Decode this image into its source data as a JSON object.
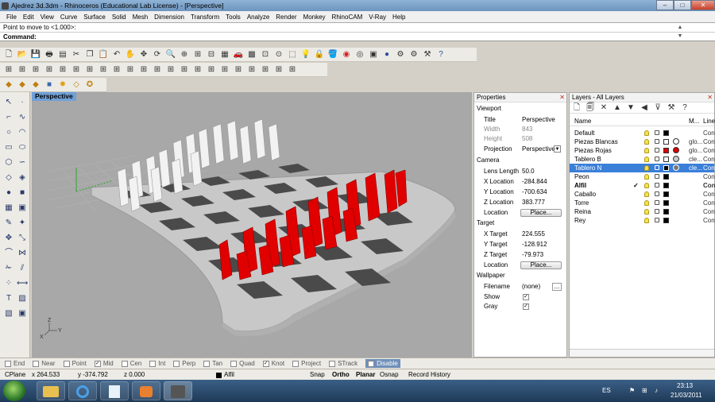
{
  "title": "Ajedrez 3d.3dm - Rhinoceros (Educational Lab License) - [Perspective]",
  "menu": [
    "File",
    "Edit",
    "View",
    "Curve",
    "Surface",
    "Solid",
    "Mesh",
    "Dimension",
    "Transform",
    "Tools",
    "Analyze",
    "Render",
    "Monkey",
    "RhinoCAM",
    "V-Ray",
    "Help"
  ],
  "command_history": "Point to move to <1.000>:",
  "command_prompt": "Command:",
  "viewport": {
    "label": "Perspective",
    "axis_y": "Y",
    "axis_z": "Z",
    "axis_x": "X"
  },
  "properties": {
    "header": "Properties",
    "viewport_section": "Viewport",
    "title_key": "Title",
    "title_val": "Perspective",
    "width_key": "Width",
    "width_val": "843",
    "height_key": "Height",
    "height_val": "508",
    "projection_key": "Projection",
    "projection_val": "Perspective",
    "camera_section": "Camera",
    "lens_key": "Lens Length",
    "lens_val": "50.0",
    "cx_key": "X Location",
    "cx_val": "-284.844",
    "cy_key": "Y Location",
    "cy_val": "-700.634",
    "cz_key": "Z Location",
    "cz_val": "383.777",
    "cloc_key": "Location",
    "place_btn": "Place...",
    "target_section": "Target",
    "tx_key": "X Target",
    "tx_val": "224.555",
    "ty_key": "Y Target",
    "ty_val": "-128.912",
    "tz_key": "Z Target",
    "tz_val": "-79.973",
    "tloc_key": "Location",
    "place_btn2": "Place...",
    "wallpaper_section": "Wallpaper",
    "file_key": "Filename",
    "file_val": "(none)",
    "browse": "...",
    "show_key": "Show",
    "gray_key": "Gray"
  },
  "layers": {
    "header": "Layers - All Layers",
    "col_name": "Name",
    "col_m": "M...",
    "col_l": "Line",
    "rows": [
      {
        "name": "Default",
        "color": "#000000",
        "mat": "",
        "line": "Con"
      },
      {
        "name": "Piezas Blancas",
        "color": "#ffffff",
        "mat": "glo...",
        "line": "Con"
      },
      {
        "name": "Piezas Rojas",
        "color": "#dd0000",
        "mat": "glo...",
        "line": "Con"
      },
      {
        "name": "Tablero B",
        "color": "#ffffff",
        "mat": "cle...",
        "line": "Con"
      },
      {
        "name": "Tablero N",
        "color": "#000000",
        "mat": "cle...",
        "line": "Con"
      },
      {
        "name": "Peon",
        "color": "#000000",
        "mat": "",
        "line": "Con"
      },
      {
        "name": "Alfil",
        "color": "#000000",
        "mat": "",
        "line": "Con"
      },
      {
        "name": "Caballo",
        "color": "#000000",
        "mat": "",
        "line": "Con"
      },
      {
        "name": "Torre",
        "color": "#000000",
        "mat": "",
        "line": "Con"
      },
      {
        "name": "Reina",
        "color": "#000000",
        "mat": "",
        "line": "Con"
      },
      {
        "name": "Rey",
        "color": "#000000",
        "mat": "",
        "line": "Con"
      }
    ]
  },
  "osnap": [
    {
      "label": "End",
      "checked": false
    },
    {
      "label": "Near",
      "checked": false
    },
    {
      "label": "Point",
      "checked": false
    },
    {
      "label": "Mid",
      "checked": true
    },
    {
      "label": "Cen",
      "checked": false
    },
    {
      "label": "Int",
      "checked": false
    },
    {
      "label": "Perp",
      "checked": false
    },
    {
      "label": "Tan",
      "checked": false
    },
    {
      "label": "Quad",
      "checked": false
    },
    {
      "label": "Knot",
      "checked": true
    },
    {
      "label": "Project",
      "checked": false
    },
    {
      "label": "STrack",
      "checked": false
    }
  ],
  "osnap_disable": "Disable",
  "status": {
    "cplane": "CPlane",
    "x": "x 264.533",
    "y": "y -374.792",
    "z": "z 0.000",
    "layer": "Alfil",
    "snap": "Snap",
    "ortho": "Ortho",
    "planar": "Planar",
    "osnap": "Osnap",
    "record": "Record History"
  },
  "tray": {
    "lang": "ES",
    "time": "23:13",
    "date": "21/03/2011"
  }
}
